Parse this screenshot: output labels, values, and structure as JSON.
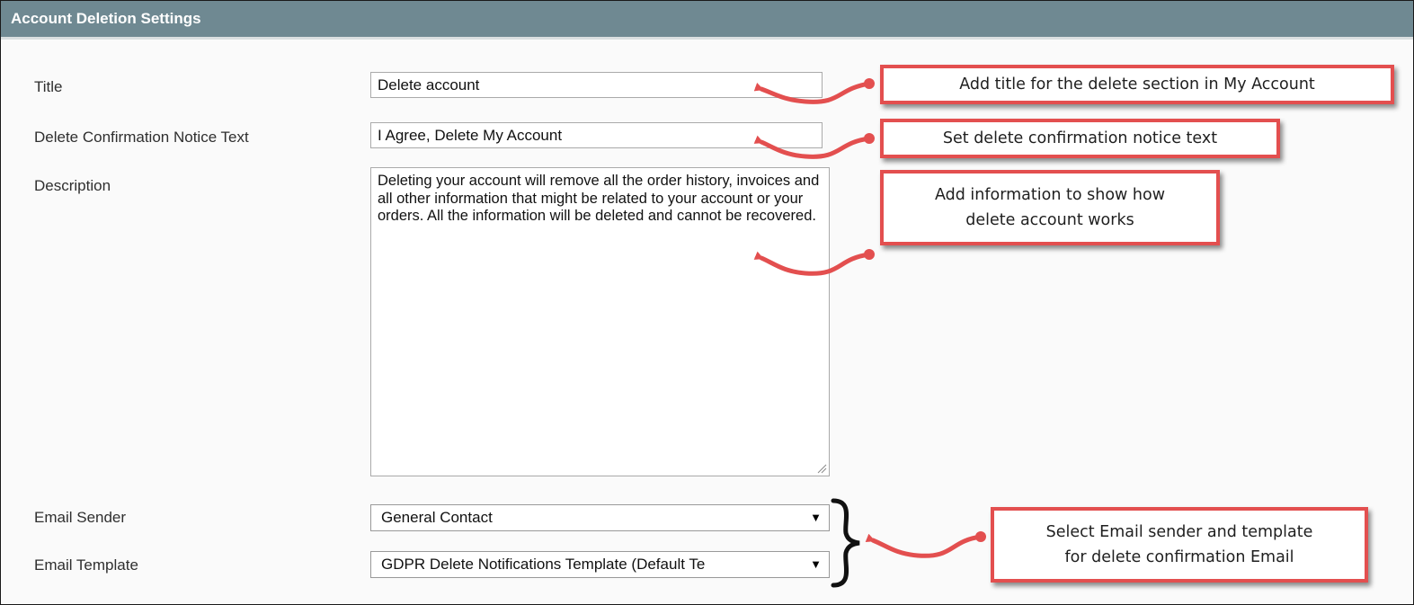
{
  "panel": {
    "title": "Account Deletion Settings"
  },
  "fields": {
    "title": {
      "label": "Title",
      "value": "Delete account"
    },
    "confirm_notice": {
      "label": "Delete Confirmation Notice Text",
      "value": "I Agree, Delete My Account"
    },
    "description": {
      "label": "Description",
      "value": "Deleting your account will remove all the order history, invoices and all other information that might be related to your account or your orders. All the information will be deleted and cannot be recovered."
    },
    "email_sender": {
      "label": "Email Sender",
      "selected": "General Contact"
    },
    "email_template": {
      "label": "Email Template",
      "selected": "GDPR Delete Notifications Template (Default Te"
    }
  },
  "annotations": {
    "title_note": "Add title for the delete section in My Account",
    "notice_note": "Set delete confirmation notice text",
    "description_note_line1": "Add information to show how",
    "description_note_line2": "delete account works",
    "email_note_line1": "Select Email sender and template",
    "email_note_line2": "for delete confirmation Email"
  },
  "icons": {
    "dropdown": "▼",
    "resize": "resize-grip-icon"
  },
  "colors": {
    "header_bg": "#6f8992",
    "annotation_red": "#e34f4f",
    "panel_bg": "#fafafa"
  }
}
